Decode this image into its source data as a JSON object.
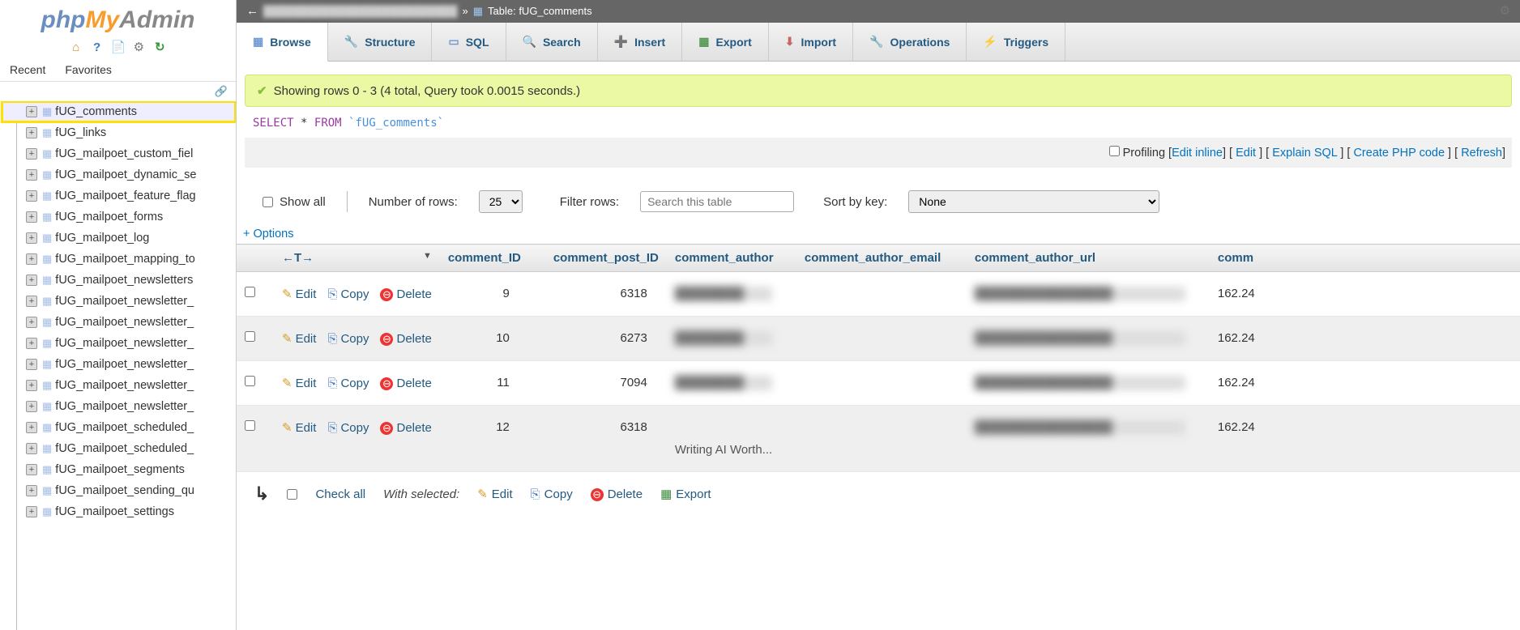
{
  "logo": {
    "php": "php",
    "my": "My",
    "admin": "Admin"
  },
  "nav": {
    "recent": "Recent",
    "favorites": "Favorites"
  },
  "tree": [
    {
      "name": "fUG_comments",
      "selected": true
    },
    {
      "name": "fUG_links"
    },
    {
      "name": "fUG_mailpoet_custom_fiel"
    },
    {
      "name": "fUG_mailpoet_dynamic_se"
    },
    {
      "name": "fUG_mailpoet_feature_flag"
    },
    {
      "name": "fUG_mailpoet_forms"
    },
    {
      "name": "fUG_mailpoet_log"
    },
    {
      "name": "fUG_mailpoet_mapping_to"
    },
    {
      "name": "fUG_mailpoet_newsletters"
    },
    {
      "name": "fUG_mailpoet_newsletter_"
    },
    {
      "name": "fUG_mailpoet_newsletter_"
    },
    {
      "name": "fUG_mailpoet_newsletter_"
    },
    {
      "name": "fUG_mailpoet_newsletter_"
    },
    {
      "name": "fUG_mailpoet_newsletter_"
    },
    {
      "name": "fUG_mailpoet_newsletter_"
    },
    {
      "name": "fUG_mailpoet_scheduled_"
    },
    {
      "name": "fUG_mailpoet_scheduled_"
    },
    {
      "name": "fUG_mailpoet_segments"
    },
    {
      "name": "fUG_mailpoet_sending_qu"
    },
    {
      "name": "fUG_mailpoet_settings"
    }
  ],
  "breadcrumb": {
    "prefix_hidden": "██████████████████████████",
    "sep": "»",
    "label": "Table: fUG_comments"
  },
  "tabs": [
    {
      "label": "Browse",
      "icon": "i-tableic",
      "active": true
    },
    {
      "label": "Structure",
      "icon": "i-struct"
    },
    {
      "label": "SQL",
      "icon": "i-sql"
    },
    {
      "label": "Search",
      "icon": "i-search"
    },
    {
      "label": "Insert",
      "icon": "i-insert"
    },
    {
      "label": "Export",
      "icon": "i-export"
    },
    {
      "label": "Import",
      "icon": "i-import"
    },
    {
      "label": "Operations",
      "icon": "i-ops"
    },
    {
      "label": "Triggers",
      "icon": "i-trigger"
    }
  ],
  "message": "Showing rows 0 - 3 (4 total, Query took 0.0015 seconds.)",
  "sql": {
    "select": "SELECT",
    "star": "*",
    "from": "FROM",
    "table": "`fUG_comments`"
  },
  "sqlactions": {
    "profiling": "Profiling",
    "edit_inline": "Edit inline",
    "edit": "Edit",
    "explain": "Explain SQL",
    "php": "Create PHP code",
    "refresh": "Refresh"
  },
  "controls": {
    "show_all": "Show all",
    "numrows_label": "Number of rows:",
    "numrows_value": "25",
    "filter_label": "Filter rows:",
    "filter_placeholder": "Search this table",
    "sort_label": "Sort by key:",
    "sort_value": "None"
  },
  "options_label": "+ Options",
  "columns": {
    "tools_left": "←T→",
    "comment_ID": "comment_ID",
    "comment_post_ID": "comment_post_ID",
    "comment_author": "comment_author",
    "comment_author_email": "comment_author_email",
    "comment_author_url": "comment_author_url",
    "comment_next": "comm"
  },
  "rowlabels": {
    "edit": "Edit",
    "copy": "Copy",
    "delete": "Delete"
  },
  "rows": [
    {
      "id": "9",
      "post_id": "6318",
      "ip": "162.24"
    },
    {
      "id": "10",
      "post_id": "6273",
      "ip": "162.24"
    },
    {
      "id": "11",
      "post_id": "7094",
      "ip": "162.24"
    },
    {
      "id": "12",
      "post_id": "6318",
      "ip": "162.24",
      "author_peek": "Writing AI Worth..."
    }
  ],
  "footer": {
    "check_all": "Check all",
    "with_selected": "With selected:",
    "edit": "Edit",
    "copy": "Copy",
    "delete": "Delete",
    "export": "Export"
  }
}
